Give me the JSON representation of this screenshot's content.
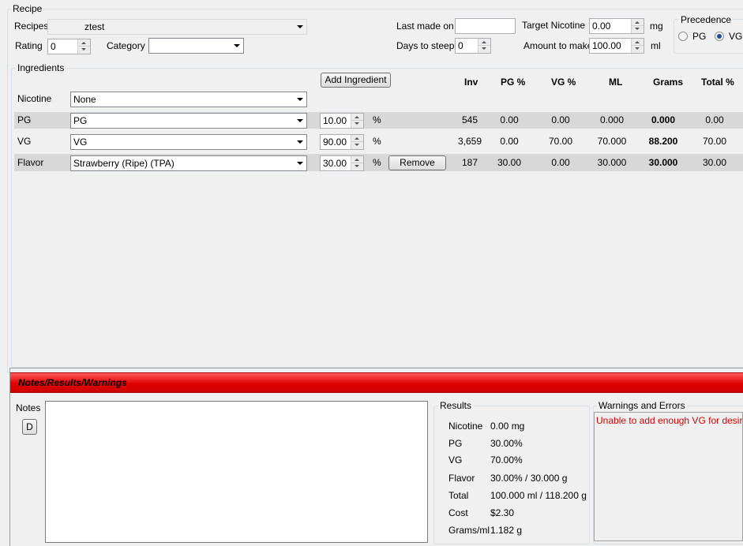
{
  "recipe_group": {
    "title": "Recipe",
    "recipes_label": "Recipes",
    "recipe_value": "ztest",
    "rating_label": "Rating",
    "rating_value": "0",
    "category_label": "Category",
    "category_value": "",
    "last_made_label": "Last made on",
    "last_made_value": "",
    "days_steep_label": "Days to steep",
    "days_steep_value": "0",
    "target_nicotine_label": "Target Nicotine",
    "target_nicotine_value": "0.00",
    "target_nicotine_unit": "mg",
    "amount_label": "Amount to make",
    "amount_value": "100.00",
    "amount_unit": "ml"
  },
  "precedence": {
    "title": "Precedence",
    "options": [
      {
        "label": "PG",
        "checked": false
      },
      {
        "label": "VG",
        "checked": true
      }
    ]
  },
  "ingredients": {
    "title": "Ingredients",
    "add_button": "Add Ingredient",
    "columns": [
      "Inv",
      "PG %",
      "VG %",
      "ML",
      "Grams",
      "Total %"
    ],
    "nicotine_label": "Nicotine",
    "nicotine_value": "None",
    "percent_sign": "%",
    "remove_button": "Remove",
    "rows": [
      {
        "label": "PG",
        "name": "PG",
        "percent": "10.00",
        "inv": "545",
        "pg": "0.00",
        "vg": "0.00",
        "ml": "0.000",
        "grams": "0.000",
        "total": "0.00"
      },
      {
        "label": "VG",
        "name": "VG",
        "percent": "90.00",
        "inv": "3,659",
        "pg": "0.00",
        "vg": "70.00",
        "ml": "70.000",
        "grams": "88.200",
        "total": "70.00"
      },
      {
        "label": "Flavor",
        "name": "Strawberry (Ripe) (TPA)",
        "percent": "30.00",
        "inv": "187",
        "pg": "30.00",
        "vg": "0.00",
        "ml": "30.000",
        "grams": "30.000",
        "total": "30.00"
      }
    ]
  },
  "notes_section": {
    "title": "Notes/Results/Warnings",
    "notes_label": "Notes",
    "d_button": "D",
    "notes_text": ""
  },
  "results": {
    "title": "Results",
    "nicotine_label": "Nicotine",
    "nicotine_value": "0.00 mg",
    "pg_label": "PG",
    "pg_value": "30.00%",
    "vg_label": "VG",
    "vg_value": "70.00%",
    "flavor_label": "Flavor",
    "flavor_value": "30.00% / 30.000 g",
    "total_label": "Total",
    "total_value": "100.000 ml / 118.200 g",
    "cost_label": "Cost",
    "cost_value": "$2.30",
    "grams_label": "Grams/ml",
    "grams_value": "1.182 g"
  },
  "warnings": {
    "title": "Warnings and Errors",
    "message": "Unable to add enough VG for desired le",
    "color": "#d40000"
  }
}
